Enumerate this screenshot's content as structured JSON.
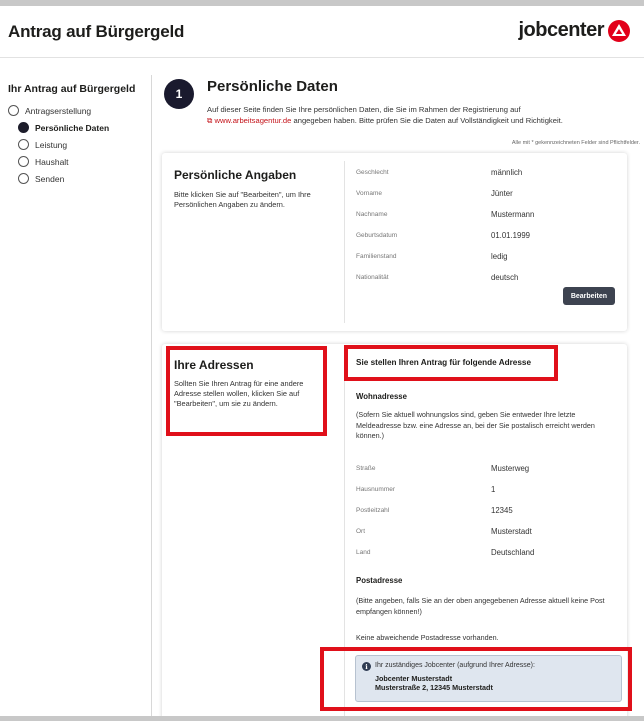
{
  "app": {
    "title": "Antrag auf Bürgergeld",
    "logo_text": "jobcenter"
  },
  "sidebar": {
    "title": "Ihr Antrag auf Bürgergeld",
    "steps": [
      {
        "label": "Antragserstellung"
      },
      {
        "label": "Persönliche Daten"
      },
      {
        "label": "Leistung"
      },
      {
        "label": "Haushalt"
      },
      {
        "label": "Senden"
      }
    ]
  },
  "main": {
    "step_number": "1",
    "title": "Persönliche Daten",
    "intro_text": "Auf dieser Seite finden Sie Ihre persönlichen Daten, die Sie im Rahmen der Registrierung auf",
    "intro_link": "www.arbeitsagentur.de",
    "intro_text2": "angegeben haben. Bitte prüfen Sie die Daten auf Vollständigkeit und Richtigkeit.",
    "required_note": "Alle mit * gekennzeichneten Felder sind Pflichtfelder."
  },
  "personal": {
    "heading": "Persönliche Angaben",
    "description": "Bitte klicken Sie auf \"Bearbeiten\", um Ihre Persönlichen Angaben zu ändern.",
    "fields": [
      {
        "label": "Geschlecht",
        "value": "männlich"
      },
      {
        "label": "Vorname",
        "value": "Jünter"
      },
      {
        "label": "Nachname",
        "value": "Mustermann"
      },
      {
        "label": "Geburtsdatum",
        "value": "01.01.1999"
      },
      {
        "label": "Familienstand",
        "value": "ledig"
      },
      {
        "label": "Nationalität",
        "value": "deutsch"
      }
    ],
    "edit_button": "Bearbeiten"
  },
  "addresses": {
    "heading": "Ihre Adressen",
    "description": "Sollten Sie Ihren Antrag für eine andere Adresse stellen wollen, klicken Sie auf \"Bearbeiten\", um sie zu ändern.",
    "section_title": "Sie stellen Ihren Antrag für folgende Adresse",
    "home_heading": "Wohnadresse",
    "home_note": "(Sofern Sie aktuell wohnungslos sind, geben Sie entweder Ihre letzte Meldeadresse bzw. eine Adresse an, bei der Sie postalisch erreicht werden können.)",
    "fields": [
      {
        "label": "Straße",
        "value": "Musterweg"
      },
      {
        "label": "Hausnummer",
        "value": "1"
      },
      {
        "label": "Postleitzahl",
        "value": "12345"
      },
      {
        "label": "Ort",
        "value": "Musterstadt"
      },
      {
        "label": "Land",
        "value": "Deutschland"
      }
    ],
    "postal_heading": "Postadresse",
    "postal_note": "(Bitte angeben, falls Sie an der oben angegebenen Adresse aktuell keine Post empfangen können!)",
    "postal_none": "Keine abweichende Postadresse vorhanden.",
    "info_title": "Ihr zuständiges Jobcenter (aufgrund Ihrer Adresse):",
    "info_name": "Jobcenter Musterstadt",
    "info_address": "Musterstraße 2, 12345 Musterstadt"
  },
  "colors": {
    "brand_red": "#e2001a",
    "highlight": "#e0101a",
    "info_bg": "#dfe6ef"
  }
}
